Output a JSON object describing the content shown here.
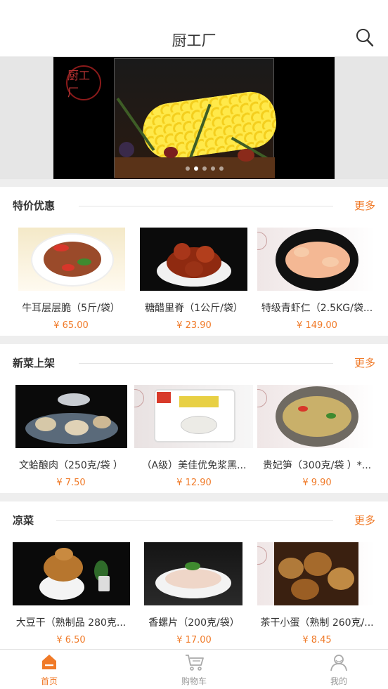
{
  "header": {
    "title": "厨工厂",
    "search_icon": "search-icon"
  },
  "banner": {
    "logo_text": "厨工厂",
    "dots": 5,
    "active_dot": 1
  },
  "sections": [
    {
      "title": "特价优惠",
      "more": "更多",
      "items": [
        {
          "name": "牛耳层层脆（5斤/袋）",
          "price": "¥ 65.00"
        },
        {
          "name": "糖醋里脊（1公斤/袋）",
          "price": "¥ 23.90"
        },
        {
          "name": "特级青虾仁（2.5KG/袋...",
          "price": "¥ 149.00"
        }
      ]
    },
    {
      "title": "新菜上架",
      "more": "更多",
      "items": [
        {
          "name": "文蛤酿肉（250克/袋 ）",
          "price": "¥ 7.50"
        },
        {
          "name": "（A级）美佳优免浆黑...",
          "price": "¥ 12.90"
        },
        {
          "name": "贵妃笋（300克/袋 ）*...",
          "price": "¥ 9.90"
        }
      ]
    },
    {
      "title": "凉菜",
      "more": "更多",
      "items": [
        {
          "name": "大豆干（熟制品 280克...",
          "price": "¥ 6.50"
        },
        {
          "name": "香螺片（200克/袋）",
          "price": "¥ 17.00"
        },
        {
          "name": "茶干小蛋（熟制 260克/...",
          "price": "¥ 8.45"
        }
      ]
    }
  ],
  "nav": [
    {
      "label": "首页",
      "icon": "home-icon",
      "active": true
    },
    {
      "label": "购物车",
      "icon": "cart-icon",
      "active": false
    },
    {
      "label": "我的",
      "icon": "user-icon",
      "active": false
    }
  ],
  "colors": {
    "accent": "#f07a28",
    "text": "#333333",
    "background": "#eeeeee"
  }
}
